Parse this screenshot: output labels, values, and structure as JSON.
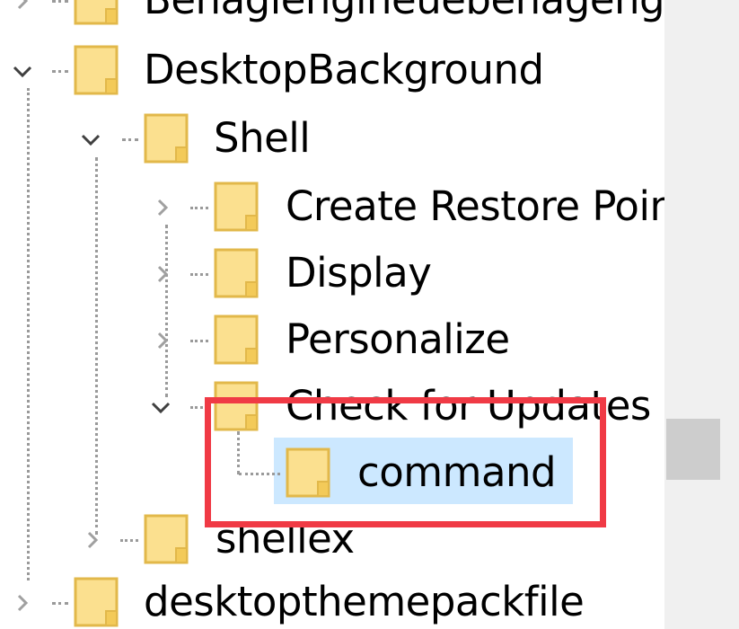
{
  "tree": {
    "nodes": [
      {
        "label": "Behaglengineuebehagengin",
        "expander": "collapsed"
      },
      {
        "label": "DesktopBackground",
        "expander": "expanded"
      },
      {
        "label": "Shell",
        "expander": "expanded"
      },
      {
        "label": "Create Restore Poin",
        "expander": "collapsed"
      },
      {
        "label": "Display",
        "expander": "collapsed"
      },
      {
        "label": "Personalize",
        "expander": "collapsed"
      },
      {
        "label": "Check for Updates",
        "expander": "expanded"
      },
      {
        "label": "command",
        "expander": "none",
        "selected": true
      },
      {
        "label": "shellex",
        "expander": "collapsed"
      },
      {
        "label": "desktopthemepackfile",
        "expander": "collapsed"
      }
    ]
  },
  "colors": {
    "folder_fill": "#fbe08f",
    "folder_edge": "#e2b84a",
    "selection": "#cce8ff",
    "highlight_box": "#f03a45"
  },
  "icons": {
    "folder": "folder-icon",
    "expanded": "chevron-down-icon",
    "collapsed": "chevron-right-icon"
  }
}
